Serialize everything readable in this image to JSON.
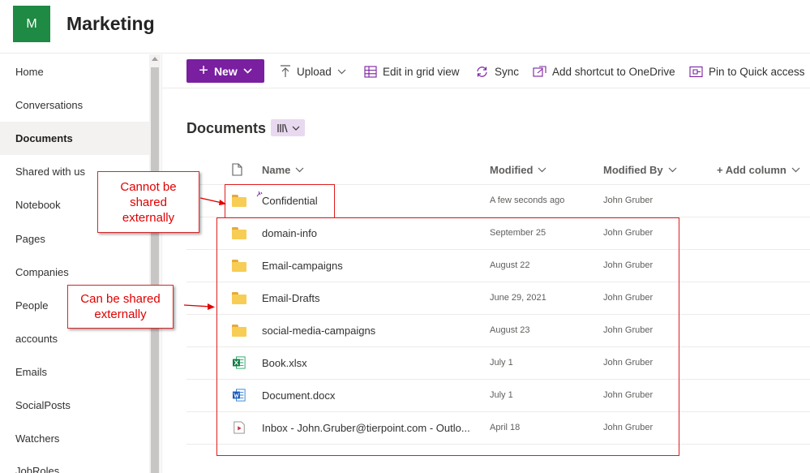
{
  "site": {
    "logo_letter": "M",
    "title": "Marketing"
  },
  "nav": {
    "items": [
      {
        "label": "Home",
        "active": false
      },
      {
        "label": "Conversations",
        "active": false
      },
      {
        "label": "Documents",
        "active": true
      },
      {
        "label": "Shared with us",
        "active": false
      },
      {
        "label": "Notebook",
        "active": false
      },
      {
        "label": "Pages",
        "active": false
      },
      {
        "label": "Companies",
        "active": false
      },
      {
        "label": "People",
        "active": false
      },
      {
        "label": "accounts",
        "active": false
      },
      {
        "label": "Emails",
        "active": false
      },
      {
        "label": "SocialPosts",
        "active": false
      },
      {
        "label": "Watchers",
        "active": false
      },
      {
        "label": "JobRoles",
        "active": false
      }
    ]
  },
  "commands": {
    "new": "New",
    "upload": "Upload",
    "edit_grid": "Edit in grid view",
    "sync": "Sync",
    "add_shortcut": "Add shortcut to OneDrive",
    "pin": "Pin to Quick access"
  },
  "library": {
    "title": "Documents"
  },
  "columns": {
    "name": "Name",
    "modified": "Modified",
    "modified_by": "Modified By",
    "add_column": "+ Add column"
  },
  "rows": [
    {
      "name": "Confidential",
      "modified": "A few seconds ago",
      "modified_by": "John Gruber",
      "type": "folder"
    },
    {
      "name": "domain-info",
      "modified": "September 25",
      "modified_by": "John Gruber",
      "type": "folder"
    },
    {
      "name": "Email-campaigns",
      "modified": "August 22",
      "modified_by": "John Gruber",
      "type": "folder"
    },
    {
      "name": "Email-Drafts",
      "modified": "June 29, 2021",
      "modified_by": "John Gruber",
      "type": "folder"
    },
    {
      "name": "social-media-campaigns",
      "modified": "August 23",
      "modified_by": "John Gruber",
      "type": "folder"
    },
    {
      "name": "Book.xlsx",
      "modified": "July 1",
      "modified_by": "John Gruber",
      "type": "excel"
    },
    {
      "name": "Document.docx",
      "modified": "July 1",
      "modified_by": "John Gruber",
      "type": "word"
    },
    {
      "name": "Inbox - John.Gruber@tierpoint.com - Outlo...",
      "modified": "April 18",
      "modified_by": "John Gruber",
      "type": "video"
    }
  ],
  "annotations": {
    "cannot_share": "Cannot be shared externally",
    "can_share": "Can be shared externally"
  },
  "colors": {
    "brand": "#7a1fa0",
    "logo": "#1e8a43",
    "annotation": "#e00000",
    "folder": "#f8cd55"
  }
}
